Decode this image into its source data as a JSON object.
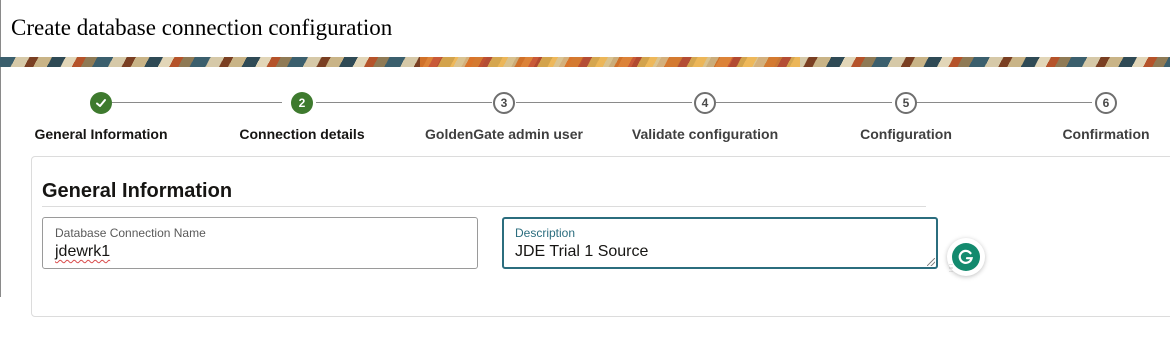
{
  "window": {
    "title": "Create database connection configuration"
  },
  "train": {
    "steps": [
      {
        "number": "1",
        "label": "General Information",
        "state": "complete",
        "icon": "checkmark-icon"
      },
      {
        "number": "2",
        "label": "Connection details",
        "state": "current"
      },
      {
        "number": "3",
        "label": "GoldenGate admin user",
        "state": "pending"
      },
      {
        "number": "4",
        "label": "Validate configuration",
        "state": "pending"
      },
      {
        "number": "5",
        "label": "Configuration",
        "state": "pending"
      },
      {
        "number": "6",
        "label": "Confirmation",
        "state": "pending"
      }
    ]
  },
  "section": {
    "title": "General Information"
  },
  "fields": {
    "connection_name": {
      "label": "Database Connection Name",
      "value": "jdewrk1"
    },
    "description": {
      "label": "Description",
      "value": "JDE Trial 1 Source"
    }
  },
  "grammarly": {
    "icon": "grammarly-icon"
  },
  "colors": {
    "step_complete": "#3e7a2e",
    "focus_border": "#2b6d7e",
    "grammarly": "#138a6e"
  }
}
